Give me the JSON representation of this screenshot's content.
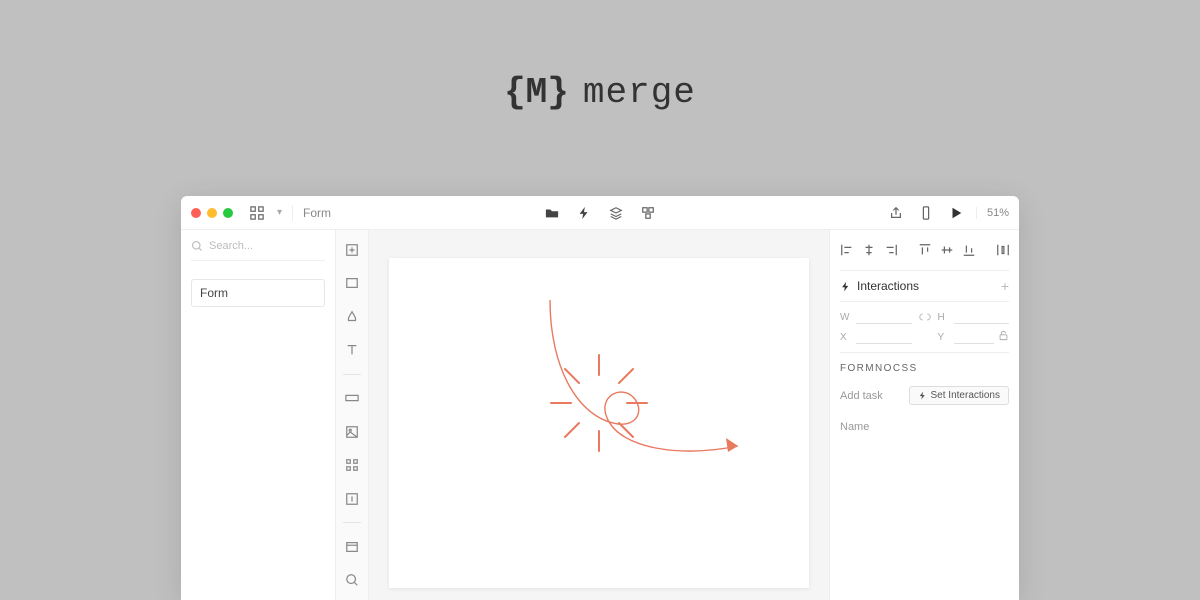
{
  "brand": {
    "mark": "{M}",
    "name": "merge"
  },
  "titlebar": {
    "doc_title": "Form",
    "zoom": "51%"
  },
  "left_panel": {
    "search_placeholder": "Search...",
    "layer_label": "Form"
  },
  "right_panel": {
    "interactions_label": "Interactions",
    "dim_w": "W",
    "dim_h": "H",
    "dim_x": "X",
    "dim_y": "Y",
    "component_label": "FORMNOCSS",
    "row1_label": "Add task",
    "set_interactions_label": "Set Interactions",
    "row2_label": "Name"
  }
}
